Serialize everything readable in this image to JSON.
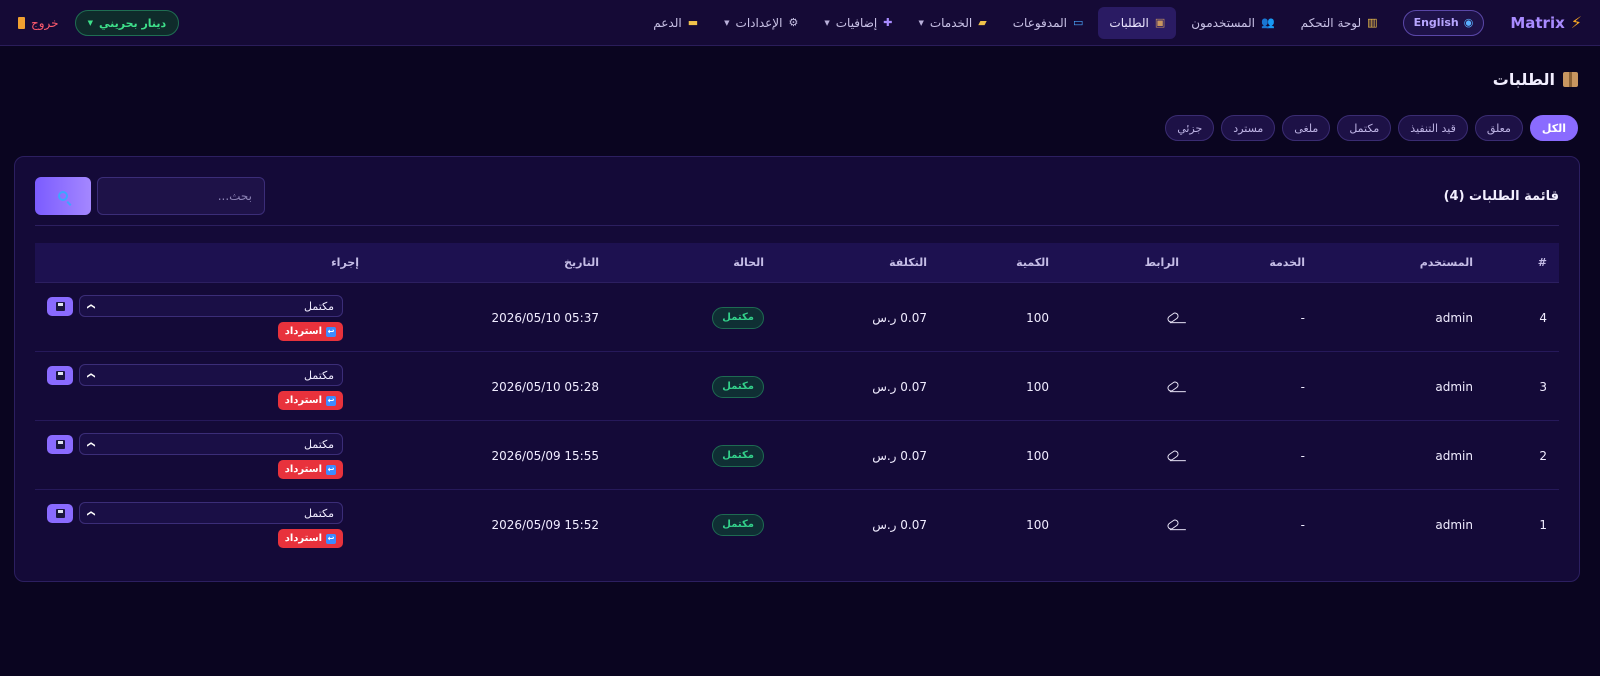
{
  "brand": {
    "name": "Matrix"
  },
  "nav": {
    "language": "English",
    "items": [
      {
        "label": "لوحة التحكم",
        "icon": "chart-icon",
        "caret": false,
        "active": false
      },
      {
        "label": "المستخدمون",
        "icon": "users-icon",
        "caret": false,
        "active": false
      },
      {
        "label": "الطلبات",
        "icon": "box-icon",
        "caret": false,
        "active": true
      },
      {
        "label": "المدفوعات",
        "icon": "card-icon",
        "caret": false,
        "active": false
      },
      {
        "label": "الخدمات",
        "icon": "folder-icon",
        "caret": true,
        "active": false
      },
      {
        "label": "إضافيات",
        "icon": "plus-icon",
        "caret": true,
        "active": false
      },
      {
        "label": "الإعدادات",
        "icon": "gear-icon",
        "caret": true,
        "active": false
      },
      {
        "label": "الدعم",
        "icon": "ticket-icon",
        "caret": false,
        "active": false
      }
    ],
    "currency": "دينار بحريني",
    "logout": "خروج"
  },
  "page": {
    "title": "الطلبات"
  },
  "filters": [
    {
      "label": "الكل",
      "active": true
    },
    {
      "label": "معلق",
      "active": false
    },
    {
      "label": "قيد التنفيذ",
      "active": false
    },
    {
      "label": "مكتمل",
      "active": false
    },
    {
      "label": "ملغى",
      "active": false
    },
    {
      "label": "مسترد",
      "active": false
    },
    {
      "label": "جزئي",
      "active": false
    }
  ],
  "card": {
    "title": "قائمة الطلبات (4)",
    "search_placeholder": "بحث..."
  },
  "table": {
    "headers": {
      "num": "#",
      "user": "المستخدم",
      "service": "الخدمة",
      "link": "الرابط",
      "qty": "الكمية",
      "cost": "التكلفة",
      "status": "الحالة",
      "date": "التاريخ",
      "action": "إجراء"
    },
    "rows": [
      {
        "num": "4",
        "user": "admin",
        "service": "-",
        "qty": "100",
        "cost": "0.07 ر.س",
        "status": "مكتمل",
        "date": "2026/05/10 05:37",
        "select_value": "مكتمل",
        "refund_label": "استرداد"
      },
      {
        "num": "3",
        "user": "admin",
        "service": "-",
        "qty": "100",
        "cost": "0.07 ر.س",
        "status": "مكتمل",
        "date": "2026/05/10 05:28",
        "select_value": "مكتمل",
        "refund_label": "استرداد"
      },
      {
        "num": "2",
        "user": "admin",
        "service": "-",
        "qty": "100",
        "cost": "0.07 ر.س",
        "status": "مكتمل",
        "date": "2026/05/09 15:55",
        "select_value": "مكتمل",
        "refund_label": "استرداد"
      },
      {
        "num": "1",
        "user": "admin",
        "service": "-",
        "qty": "100",
        "cost": "0.07 ر.س",
        "status": "مكتمل",
        "date": "2026/05/09 15:52",
        "select_value": "مكتمل",
        "refund_label": "استرداد"
      }
    ]
  },
  "colors": {
    "background": "#0a0520",
    "accent": "#8a6bff",
    "success": "#33d08a",
    "danger": "#e8323c"
  }
}
